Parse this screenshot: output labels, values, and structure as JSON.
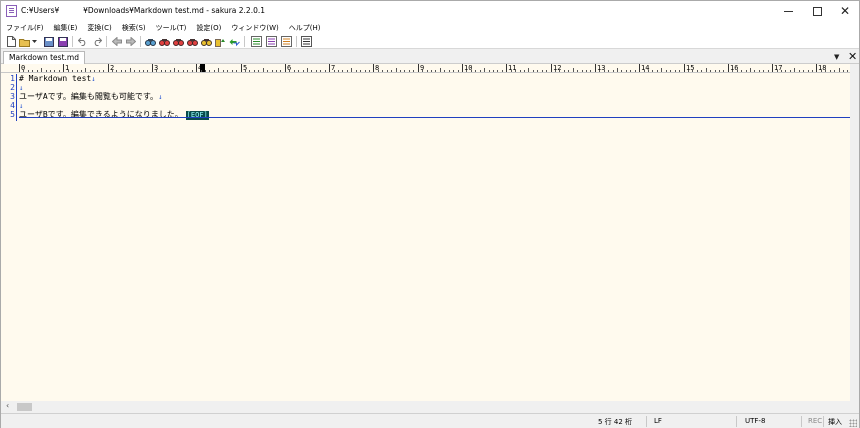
{
  "window": {
    "title_prefix": "C:¥Users¥",
    "title_suffix": "¥Downloads¥Markdown test.md - sakura 2.2.0.1",
    "close_glyph": "✕"
  },
  "menu": [
    "ファイル(F)",
    "編集(E)",
    "変換(C)",
    "検索(S)",
    "ツール(T)",
    "設定(O)",
    "ウィンドウ(W)",
    "ヘルプ(H)"
  ],
  "toolbar": {
    "icons": [
      "new-file-icon",
      "open-folder-icon",
      "dropdown-arrow-icon",
      "save-icon",
      "save-all-icon",
      "undo-icon",
      "redo-icon",
      "jump-back-icon",
      "jump-forward-icon",
      "search-icon",
      "search-prev-icon",
      "search-next-icon",
      "replace-icon",
      "mark-icon",
      "grep-icon",
      "outline-icon",
      "function-list-icon",
      "bookmark-icon",
      "settings-icon"
    ]
  },
  "tab": {
    "label": "Markdown test.md",
    "dropdown_glyph": "▼",
    "close_glyph": "✕"
  },
  "ruler": {
    "labels": [
      "0",
      "1",
      "2",
      "3",
      "4",
      "5",
      "6",
      "7",
      "8",
      "9",
      "10",
      "11",
      "12",
      "13",
      "14",
      "15",
      "16",
      "17",
      "18"
    ]
  },
  "editor": {
    "line_numbers": [
      "1",
      "2",
      "3",
      "4",
      "5"
    ],
    "lines": [
      {
        "text": "# Markdown test",
        "eol": "↓"
      },
      {
        "text": "",
        "eol": "↓"
      },
      {
        "text": "ユーザAです。編集も閲覧も可能です。",
        "eol": "↓"
      },
      {
        "text": "",
        "eol": "↓"
      },
      {
        "text": "ユーザBです。編集できるようになりました。",
        "eol": ""
      }
    ],
    "eof_marker": "[EOF]",
    "text_color": "#000000",
    "line_number_color": "#2040c0",
    "background": "#fffaee",
    "eof_background": "#0a4a4a"
  },
  "status": {
    "position": "5 行  42 桁",
    "eol": "LF",
    "encoding": "UTF-8",
    "rec": "REC",
    "mode": "挿入"
  }
}
